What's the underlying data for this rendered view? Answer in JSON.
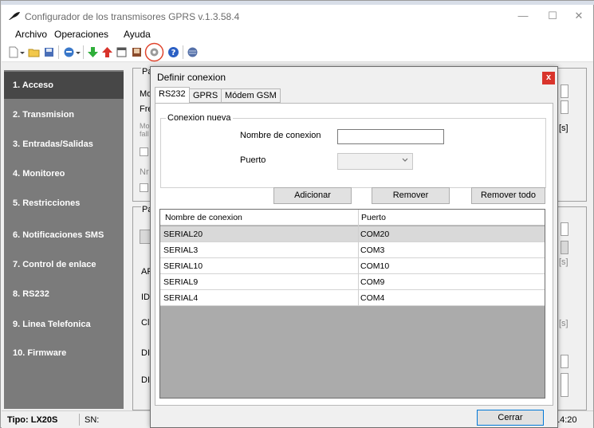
{
  "window": {
    "title": "Configurador de los transmisores GPRS v.1.3.58.4",
    "minimize": "—",
    "maximize": "☐",
    "close": "✕"
  },
  "menu": [
    "Archivo",
    "Operaciones",
    "Ayuda"
  ],
  "sidebar": {
    "items": [
      {
        "label": "1. Acceso"
      },
      {
        "label": "2. Transmision"
      },
      {
        "label": "3. Entradas/Salidas"
      },
      {
        "label": "4. Monitoreo"
      },
      {
        "label": "5. Restricciones"
      },
      {
        "label": "6. Notificaciones SMS"
      },
      {
        "label": "7. Control de enlace"
      },
      {
        "label": "8. RS232"
      },
      {
        "label": "9. Linea Telefonica"
      },
      {
        "label": "10. Firmware"
      }
    ]
  },
  "background_fragments": {
    "pa1": "Pa",
    "mo1": "Mo",
    "fre": "Fre",
    "mo2": "Mo",
    "fal": "fall",
    "nr": "Nr",
    "pa2": "Pa",
    "ap": "AP",
    "id": "ID",
    "cl": "Cl",
    "di1": "DI",
    "di2": "DI",
    "s1": "[s]",
    "s2": "[s]",
    "s3": "[s]"
  },
  "dialog": {
    "title": "Definir conexion",
    "close": "x",
    "tabs": [
      {
        "label": "RS232"
      },
      {
        "label": "GPRS"
      },
      {
        "label": "Módem GSM"
      }
    ],
    "group_title": "Conexion nueva",
    "name_label": "Nombre de conexion",
    "name_value": "",
    "port_label": "Puerto",
    "port_value": "",
    "buttons": {
      "add": "Adicionar",
      "remove": "Remover",
      "remove_all": "Remover todo"
    },
    "table": {
      "columns": [
        "Nombre de conexion",
        "Puerto"
      ],
      "rows": [
        {
          "name": "SERIAL20",
          "port": "COM20"
        },
        {
          "name": "SERIAL3",
          "port": "COM3"
        },
        {
          "name": "SERIAL10",
          "port": "COM10"
        },
        {
          "name": "SERIAL9",
          "port": "COM9"
        },
        {
          "name": "SERIAL4",
          "port": "COM4"
        }
      ]
    },
    "close_button": "Cerrar"
  },
  "statusbar": {
    "type": "Tipo: LX20S",
    "sn": "SN:",
    "time": "14:20"
  },
  "colors": {
    "sidebar_bg": "#7b7b7b",
    "sidebar_active": "#474747",
    "dialog_close": "#d9342b",
    "selected_row": "#d9d9d9",
    "grid_empty": "#ababab"
  }
}
